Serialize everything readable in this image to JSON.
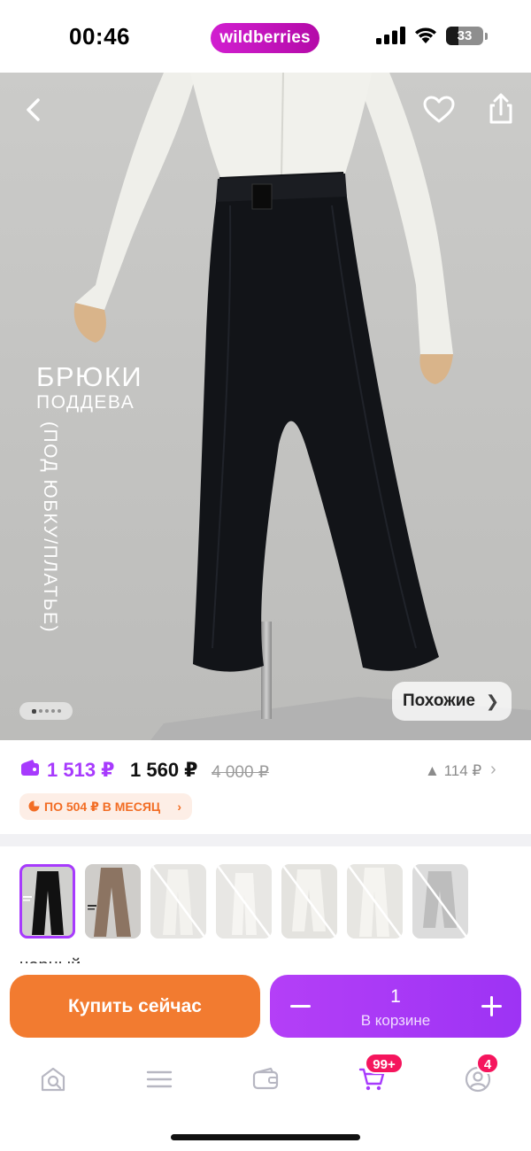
{
  "status_bar": {
    "time": "00:46",
    "brand": "wildberries",
    "battery": "33",
    "battery_level": 0.33
  },
  "photo": {
    "title": "БРЮКИ",
    "subtitle": "ПОДДЕВА",
    "vertical_text": "(ПОД ЮБКУ/ПЛАТЬЕ)",
    "similar_label": "Похожие",
    "pager": {
      "count": 5,
      "active": 1
    }
  },
  "price": {
    "wallet_price": "1 513 ₽",
    "price": "1 560 ₽",
    "old_price": "4 000 ₽",
    "change": "114 ₽",
    "installment": "ПО 504 ₽ В МЕСЯЦ"
  },
  "variants": {
    "selected_index": 0,
    "color_label": "черный",
    "thumbs": [
      {
        "name": "black"
      },
      {
        "name": "beige-brown"
      },
      {
        "name": "unavailable"
      },
      {
        "name": "unavailable"
      },
      {
        "name": "unavailable"
      },
      {
        "name": "unavailable"
      },
      {
        "name": "unavailable"
      }
    ]
  },
  "actions": {
    "buy_now": "Купить сейчас",
    "cart_qty": "1",
    "cart_label": "В корзине"
  },
  "tabbar": {
    "items": [
      {
        "icon": "search-icon"
      },
      {
        "icon": "menu-icon"
      },
      {
        "icon": "wallet-icon"
      },
      {
        "icon": "cart-icon",
        "badge": "99+"
      },
      {
        "icon": "profile-icon",
        "badge": "4"
      }
    ]
  },
  "colors": {
    "brand": "#cb11ab",
    "accent_purple": "#a73afd",
    "orange": "#f27b30",
    "badge_red": "#f5155d"
  }
}
